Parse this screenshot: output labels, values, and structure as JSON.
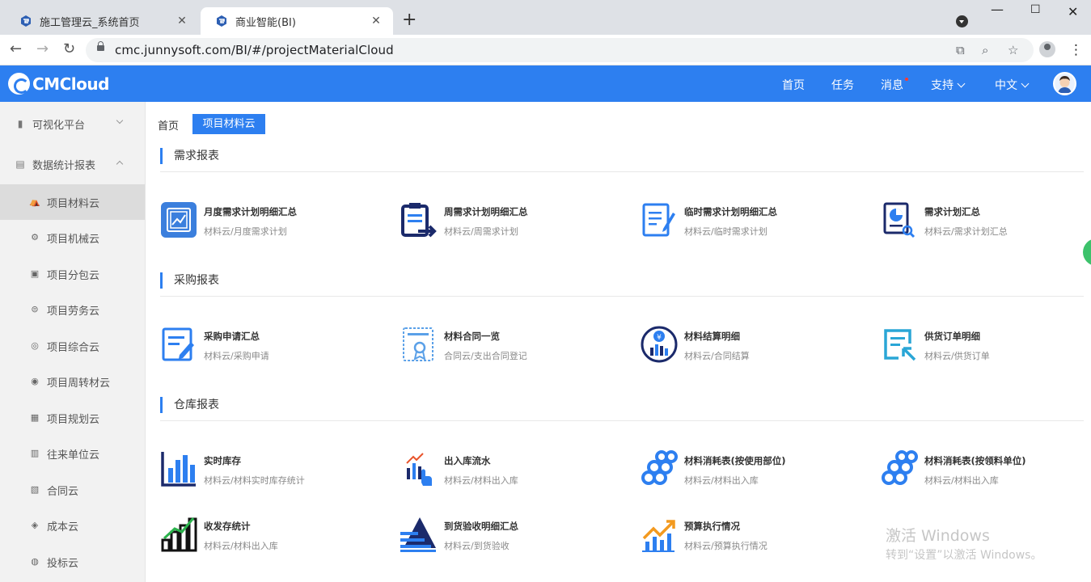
{
  "browser": {
    "tabs": [
      {
        "title": "施工管理云_系统首页",
        "active": false
      },
      {
        "title": "商业智能(BI)",
        "active": true
      }
    ],
    "url": "cmc.junnysoft.com/BI/#/projectMaterialCloud"
  },
  "header": {
    "logo": "CMCloud",
    "nav": {
      "home": "首页",
      "tasks": "任务",
      "messages": "消息",
      "support": "支持",
      "language": "中文"
    }
  },
  "sidebar": {
    "groups": [
      {
        "label": "可视化平台",
        "expanded": false
      },
      {
        "label": "数据统计报表",
        "expanded": true
      }
    ],
    "items": [
      {
        "label": "项目材料云",
        "active": true
      },
      {
        "label": "项目机械云"
      },
      {
        "label": "项目分包云"
      },
      {
        "label": "项目劳务云"
      },
      {
        "label": "项目综合云"
      },
      {
        "label": "项目周转材云"
      },
      {
        "label": "项目规划云"
      },
      {
        "label": "往来单位云"
      },
      {
        "label": "合同云"
      },
      {
        "label": "成本云"
      },
      {
        "label": "投标云"
      }
    ]
  },
  "breadcrumb": {
    "home": "首页",
    "current": "项目材料云"
  },
  "sections": [
    {
      "title": "需求报表",
      "cards": [
        {
          "title": "月度需求计划明细汇总",
          "sub": "材料云/月度需求计划",
          "icon": "monthly-chart-icon"
        },
        {
          "title": "周需求计划明细汇总",
          "sub": "材料云/周需求计划",
          "icon": "clipboard-arrow-icon"
        },
        {
          "title": "临时需求计划明细汇总",
          "sub": "材料云/临时需求计划",
          "icon": "document-edit-icon"
        },
        {
          "title": "需求计划汇总",
          "sub": "材料云/需求计划汇总",
          "icon": "pie-report-icon"
        }
      ]
    },
    {
      "title": "采购报表",
      "cards": [
        {
          "title": "采购申请汇总",
          "sub": "材料云/采购申请",
          "icon": "form-pen-icon"
        },
        {
          "title": "材料合同一览",
          "sub": "合同云/支出合同登记",
          "icon": "certificate-icon"
        },
        {
          "title": "材料结算明细",
          "sub": "材料云/合同结算",
          "icon": "yen-chart-icon"
        },
        {
          "title": "供货订单明细",
          "sub": "材料云/供货订单",
          "icon": "order-arrow-icon"
        }
      ]
    },
    {
      "title": "仓库报表",
      "cards": [
        {
          "title": "实时库存",
          "sub": "材料云/材料实时库存统计",
          "icon": "bar-chart-icon"
        },
        {
          "title": "出入库流水",
          "sub": "材料云/材料出入库",
          "icon": "touch-chart-icon"
        },
        {
          "title": "材料消耗表(按使用部位)",
          "sub": "材料云/材料出入库",
          "icon": "pipes-icon"
        },
        {
          "title": "材料消耗表(按领料单位)",
          "sub": "材料云/材料出入库",
          "icon": "pipes-icon"
        },
        {
          "title": "收发存统计",
          "sub": "材料云/材料出入库",
          "icon": "growth-bars-icon"
        },
        {
          "title": "到货验收明细汇总",
          "sub": "材料云/到货验收",
          "icon": "pyramid-icon"
        },
        {
          "title": "预算执行情况",
          "sub": "材料云/预算执行情况",
          "icon": "trend-up-icon"
        }
      ]
    }
  ],
  "watermark": {
    "line1": "激活 Windows",
    "line2": "转到“设置”以激活 Windows。"
  },
  "colors": {
    "accent": "#2d7ff0",
    "navy": "#1b2a6b",
    "sidebar_bg": "#f2f2f2"
  }
}
